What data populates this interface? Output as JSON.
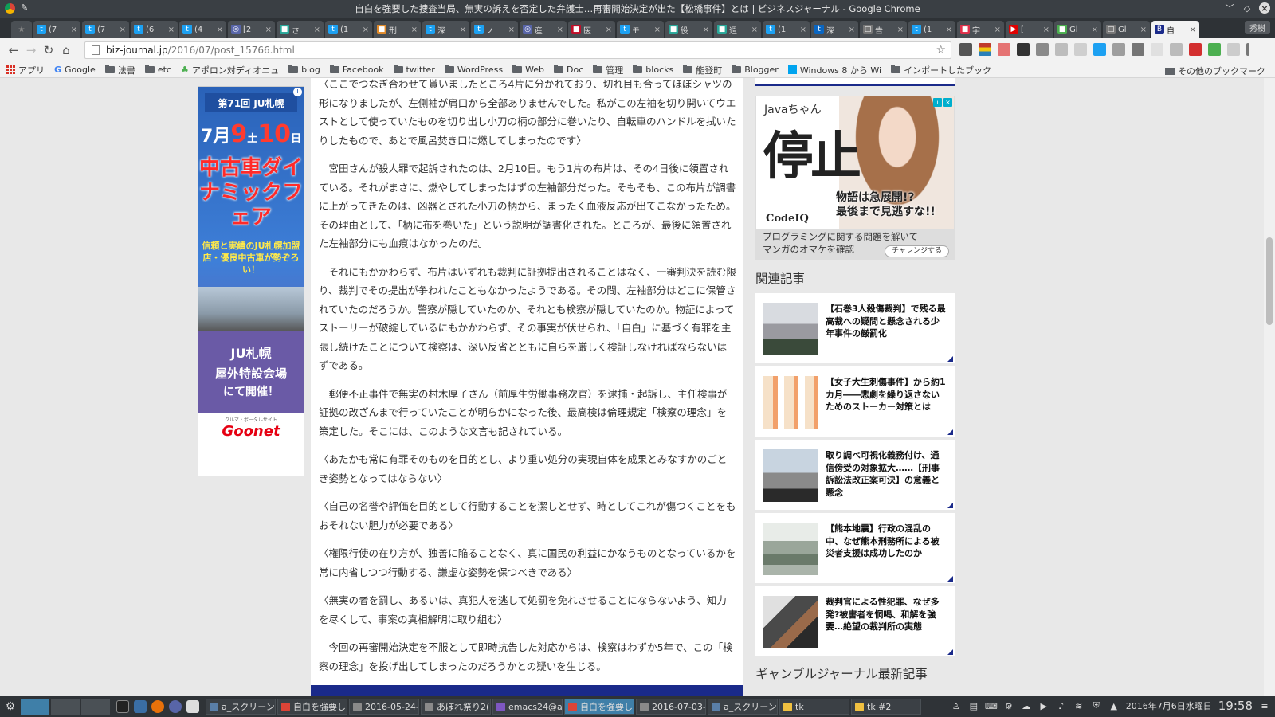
{
  "window": {
    "title": "自白を強要した捜査当局、無実の訴えを否定した弁護士…再審開始決定が出た【松橋事件】とは | ビジネスジャーナル - Google Chrome",
    "profile": "秀樹"
  },
  "tabs": [
    {
      "label": "(7",
      "color": "#1da1f2",
      "glyph": "t"
    },
    {
      "label": "(7",
      "color": "#1da1f2",
      "glyph": "t"
    },
    {
      "label": "(6",
      "color": "#1da1f2",
      "glyph": "t"
    },
    {
      "label": "(4",
      "color": "#1da1f2",
      "glyph": "t"
    },
    {
      "label": "[2",
      "color": "#5865a8",
      "glyph": "◎"
    },
    {
      "label": "さ",
      "color": "#2aa89a",
      "glyph": "■"
    },
    {
      "label": "(1",
      "color": "#1da1f2",
      "glyph": "t"
    },
    {
      "label": "刑",
      "color": "#e08a2a",
      "glyph": "■"
    },
    {
      "label": "深",
      "color": "#1da1f2",
      "glyph": "t"
    },
    {
      "label": "ノ",
      "color": "#1da1f2",
      "glyph": "t"
    },
    {
      "label": "産",
      "color": "#5865a8",
      "glyph": "◎"
    },
    {
      "label": "医",
      "color": "#c0102a",
      "glyph": "■"
    },
    {
      "label": "モ",
      "color": "#1da1f2",
      "glyph": "t"
    },
    {
      "label": "役",
      "color": "#2aa89a",
      "glyph": "■"
    },
    {
      "label": "週",
      "color": "#2aa89a",
      "glyph": "■"
    },
    {
      "label": "(1",
      "color": "#1da1f2",
      "glyph": "t"
    },
    {
      "label": "深",
      "color": "#0a66c2",
      "glyph": "t"
    },
    {
      "label": "告",
      "color": "#777777",
      "glyph": "□"
    },
    {
      "label": "(1",
      "color": "#1da1f2",
      "glyph": "t"
    },
    {
      "label": "宇",
      "color": "#e0304a",
      "glyph": "■"
    },
    {
      "label": "[",
      "color": "#e00000",
      "glyph": "▶"
    },
    {
      "label": "Gl",
      "color": "#4caf50",
      "glyph": "■"
    },
    {
      "label": "Gl",
      "color": "#777777",
      "glyph": "□"
    },
    {
      "label": "自",
      "color": "#1a2a8a",
      "glyph": "B"
    }
  ],
  "address_bar": {
    "host": "biz-journal.jp",
    "path": "/2016/07/post_15766.html"
  },
  "bookmarks": [
    {
      "label": "アプリ",
      "type": "apps"
    },
    {
      "label": "Google",
      "type": "google"
    },
    {
      "label": "法書",
      "type": "folder"
    },
    {
      "label": "etc",
      "type": "folder"
    },
    {
      "label": "アポロン対ディオニュ",
      "type": "leaf"
    },
    {
      "label": "blog",
      "type": "folder"
    },
    {
      "label": "Facebook",
      "type": "folder"
    },
    {
      "label": "twitter",
      "type": "folder"
    },
    {
      "label": "WordPress",
      "type": "folder"
    },
    {
      "label": "Web",
      "type": "folder"
    },
    {
      "label": "Doc",
      "type": "folder"
    },
    {
      "label": "管理",
      "type": "folder"
    },
    {
      "label": "blocks",
      "type": "folder"
    },
    {
      "label": "能登町",
      "type": "folder"
    },
    {
      "label": "Blogger",
      "type": "folder"
    },
    {
      "label": "Windows 8 から Wi",
      "type": "win"
    },
    {
      "label": "インポートしたブック",
      "type": "folder"
    }
  ],
  "bookmarks_other": "その他のブックマーク",
  "left_ad": {
    "top": "第71回 JU札幌",
    "date_month": "7月",
    "date_d1": "9",
    "date_d1_dow": "土",
    "date_d2": "10",
    "date_d2_dow": "日",
    "headline": "中古車ダイナミックフェア",
    "sub": "信頼と実績のJU札幌加盟店・優良中古車が勢ぞろい！",
    "venue1": "JU札幌",
    "venue2": "屋外特設会場",
    "venue3": "にて開催！",
    "portal": "クルマ・ポータルサイト",
    "brand": "Goonet"
  },
  "article": {
    "paragraphs": [
      "〈ここでつなぎ合わせて貰いましたところ4片に分かれており、切れ目も合ってほぼシャツの形になりましたが、左側袖が肩口から全部ありませんでした。私がこの左袖を切り開いてウエストとして使っていたものを切り出し小刀の柄の部分に巻いたり、自転車のハンドルを拭いたりしたもので、あとで風呂焚き口に燃してしまったのです〉",
      "宮田さんが殺人罪で起訴されたのは、2月10日。もう1片の布片は、その4日後に領置されている。それがまさに、燃やしてしまったはずの左袖部分だった。そもそも、この布片が調書に上がってきたのは、凶器とされた小刀の柄から、まったく血液反応が出てこなかったため。その理由として、「柄に布を巻いた」という説明が調書化された。ところが、最後に領置された左袖部分にも血痕はなかったのだ。",
      "それにもかかわらず、布片はいずれも裁判に証拠提出されることはなく、一審判決を読む限り、裁判でその提出が争われたこともなかったようである。その間、左袖部分はどこに保管されていたのだろうか。警察が隠していたのか、それとも検察が隠していたのか。物証によってストーリーが破綻しているにもかかわらず、その事実が伏せられ、「自白」に基づく有罪を主張し続けたことについて検察は、深い反省とともに自らを厳しく検証しなければならないはずである。",
      "郵便不正事件で無実の村木厚子さん（前厚生労働事務次官）を逮捕・起訴し、主任検事が証拠の改ざんまで行っていたことが明らかになった後、最高検は倫理規定「検察の理念」を策定した。そこには、このような文言も記されている。",
      "〈あたかも常に有罪そのものを目的とし、より重い処分の実現自体を成果とみなすかのごとき姿勢となってはならない〉",
      "〈自己の名誉や評価を目的として行動することを潔しとせず、時としてこれが傷つくことをもおそれない胆力が必要である〉",
      "〈権限行使の在り方が、独善に陥ることなく、真に国民の利益にかなうものとなっているかを常に内省しつつ行動する、謙虚な姿勢を保つべきである〉",
      "〈無実の者を罰し、あるいは、真犯人を逃して処罰を免れさせることにならないよう、知力を尽くして、事案の真相解明に取り組む〉",
      "今回の再審開始決定を不服として即時抗告した対応からは、検察はわずか5年で、この「検察の理念」を投げ出してしまったのだろうかとの疑いを生じる。"
    ]
  },
  "sidebar": {
    "ad": {
      "tag": "Javaちゃん",
      "big": "停止",
      "copy1": "物語は急展開!?",
      "copy2": "最後まで見逃すな!!",
      "brand": "CodeIQ",
      "banner1": "プログラミングに関する問題を解いて",
      "banner2": "マンガのオマケを確認",
      "cta": "チャレンジする"
    },
    "related_heading": "関連記事",
    "related": [
      {
        "title": "【石巻3人殺傷裁判】で残る最高裁への疑問と懸念される少年事件の厳罰化"
      },
      {
        "title": "【女子大生刺傷事件】から約1カ月――悲劇を繰り返さないためのストーカー対策とは"
      },
      {
        "title": "取り調べ可視化義務付け、通信傍受の対象拡大……【刑事訴訟法改正案可決】の意義と懸念"
      },
      {
        "title": "【熊本地震】行政の混乱の中、なぜ熊本刑務所による被災者支援は成功したのか"
      },
      {
        "title": "裁判官による性犯罪、なぜ多発?被害者を恫喝、和解を強要…絶望の裁判所の実態"
      }
    ],
    "latest_heading": "ギャンブルジャーナル最新記事"
  },
  "taskbar": {
    "tasks": [
      {
        "label": "a_スクリーン",
        "color": "#5a7fa8"
      },
      {
        "label": "自白を強要し",
        "color": "#db4437"
      },
      {
        "label": "2016-05-24-",
        "color": "#8a8a8a"
      },
      {
        "label": "あぼれ祭り2(",
        "color": "#8a8a8a"
      },
      {
        "label": "emacs24@a",
        "color": "#7e57c2"
      },
      {
        "label": "自白を強要し",
        "color": "#db4437"
      },
      {
        "label": "2016-07-03-",
        "color": "#8a8a8a"
      },
      {
        "label": "a_スクリーン",
        "color": "#5a7fa8"
      },
      {
        "label": "tk",
        "color": "#f0c040"
      },
      {
        "label": "tk #2",
        "color": "#f0c040"
      }
    ],
    "date": "2016年7月6日水曜日",
    "time": "19:58"
  }
}
